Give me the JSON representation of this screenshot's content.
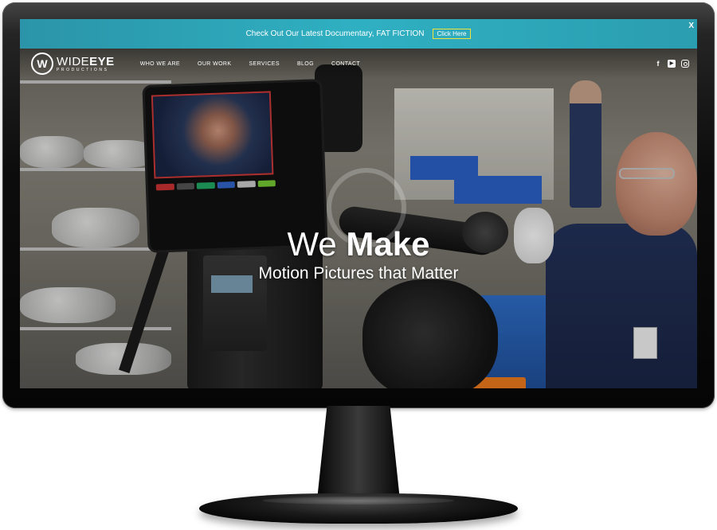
{
  "announcement": {
    "text": "Check Out Our Latest Documentary, FAT FICTION",
    "button_label": "Click Here",
    "close_label": "X"
  },
  "logo": {
    "mark": "W",
    "name_light": "WIDE",
    "name_bold": "EYE",
    "subtitle": "PRODUCTIONS"
  },
  "nav": {
    "items": [
      {
        "label": "WHO WE ARE"
      },
      {
        "label": "OUR WORK"
      },
      {
        "label": "SERVICES"
      },
      {
        "label": "BLOG"
      },
      {
        "label": "CONTACT"
      }
    ]
  },
  "social": {
    "facebook": "f",
    "youtube": "▶",
    "instagram": ""
  },
  "hero": {
    "line1_light": "We ",
    "line1_bold": "Make",
    "line2": "Motion Pictures that Matter"
  },
  "colors": {
    "announce_bar": "#2fb0c2",
    "button_border": "#f2e33c"
  }
}
